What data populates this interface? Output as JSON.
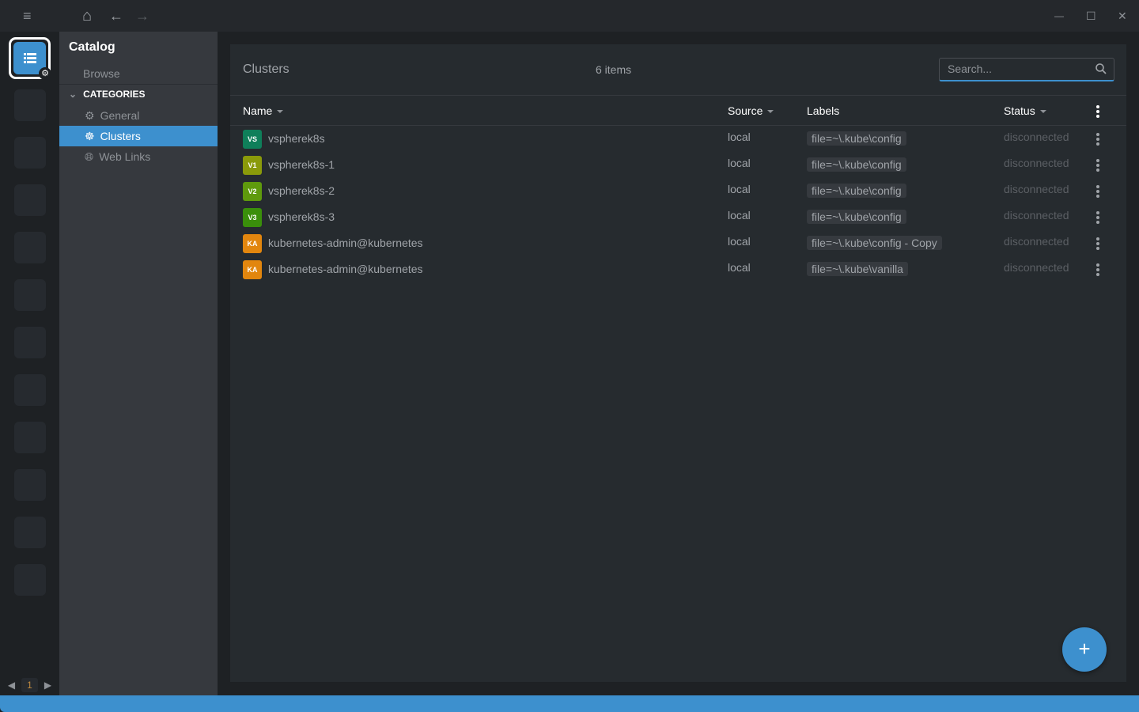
{
  "titlebar": {
    "menu": "≡",
    "home": "⌂",
    "back": "←",
    "forward": "→",
    "minimize": "—",
    "maximize": "☐",
    "close": "✕"
  },
  "hotbar": {
    "page": "1"
  },
  "sidebar": {
    "title": "Catalog",
    "browse": "Browse",
    "categories_label": "CATEGORIES",
    "items": [
      {
        "label": "General",
        "icon": "gear-icon"
      },
      {
        "label": "Clusters",
        "icon": "kubernetes-icon"
      },
      {
        "label": "Web Links",
        "icon": "globe-icon"
      }
    ]
  },
  "main": {
    "title": "Clusters",
    "count": "6 items",
    "search_placeholder": "Search...",
    "columns": {
      "name": "Name",
      "source": "Source",
      "labels": "Labels",
      "status": "Status"
    },
    "rows": [
      {
        "initials": "VS",
        "color": "#0f7f5a",
        "name": "vspherek8s",
        "source": "local",
        "label": "file=~\\.kube\\config",
        "status": "disconnected"
      },
      {
        "initials": "V1",
        "color": "#8a9a0a",
        "name": "vspherek8s-1",
        "source": "local",
        "label": "file=~\\.kube\\config",
        "status": "disconnected"
      },
      {
        "initials": "V2",
        "color": "#5f9a0d",
        "name": "vspherek8s-2",
        "source": "local",
        "label": "file=~\\.kube\\config",
        "status": "disconnected"
      },
      {
        "initials": "V3",
        "color": "#3a8f0b",
        "name": "vspherek8s-3",
        "source": "local",
        "label": "file=~\\.kube\\config",
        "status": "disconnected"
      },
      {
        "initials": "KA",
        "color": "#e2860e",
        "name": "kubernetes-admin@kubernetes",
        "source": "local",
        "label": "file=~\\.kube\\config - Copy",
        "status": "disconnected"
      },
      {
        "initials": "KA",
        "color": "#e2860e",
        "name": "kubernetes-admin@kubernetes",
        "source": "local",
        "label": "file=~\\.kube\\vanilla",
        "status": "disconnected"
      }
    ],
    "add": "+"
  }
}
